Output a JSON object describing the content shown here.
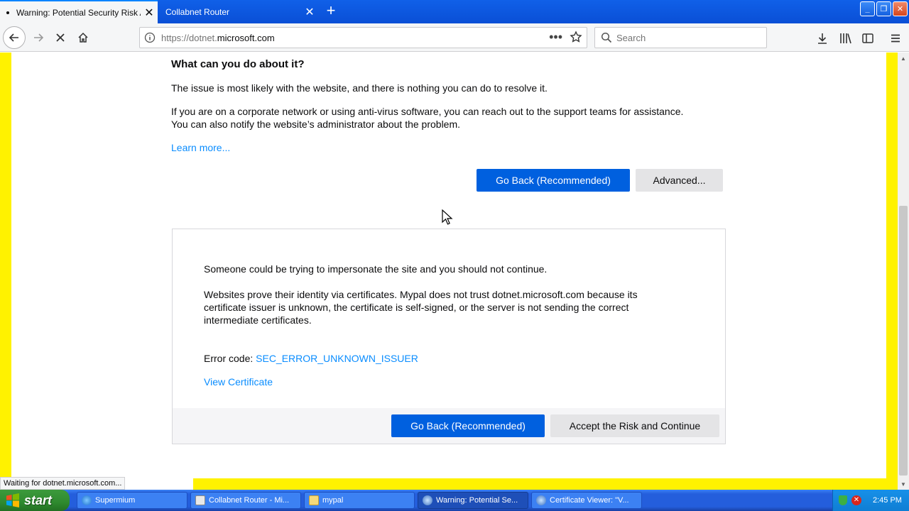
{
  "browser": {
    "tabs": [
      {
        "label": "Warning: Potential Security Risk Ahead",
        "active": true
      },
      {
        "label": "Collabnet Router",
        "active": false
      }
    ],
    "url": {
      "prefix": "https://dotnet.",
      "domain": "microsoft.com"
    },
    "search_placeholder": "Search",
    "status_text": "Waiting for dotnet.microsoft.com..."
  },
  "page": {
    "heading": "What can you do about it?",
    "para1": "The issue is most likely with the website, and there is nothing you can do to resolve it.",
    "para2_line1": "If you are on a corporate network or using anti-virus software, you can reach out to the support teams for assistance.",
    "para2_line2": "You can also notify the website’s administrator about the problem.",
    "learn_more": "Learn more...",
    "go_back_label": "Go Back (Recommended)",
    "advanced_label": "Advanced...",
    "advanced": {
      "intro": "Someone could be trying to impersonate the site and you should not continue.",
      "details": "Websites prove their identity via certificates. Mypal does not trust dotnet.microsoft.com because its certificate issuer is unknown, the certificate is self-signed, or the server is not sending the correct intermediate certificates.",
      "error_code_label": "Error code:",
      "error_code": "SEC_ERROR_UNKNOWN_ISSUER",
      "view_certificate": "View Certificate",
      "go_back_label": "Go Back (Recommended)",
      "accept_label": "Accept the Risk and Continue"
    }
  },
  "taskbar": {
    "start_label": "start",
    "tasks": [
      {
        "label": "Supermium",
        "active": false
      },
      {
        "label": "Collabnet Router - Mi...",
        "active": false
      },
      {
        "label": "mypal",
        "active": false
      },
      {
        "label": "Warning: Potential Se...",
        "active": true
      },
      {
        "label": "Certificate Viewer: \"V...",
        "active": false
      }
    ],
    "clock": "2:45 PM"
  },
  "colors": {
    "accent": "#0060df",
    "link": "#0a8dff",
    "warning_stripe": "#fff200",
    "taskbar_blue": "#245edc",
    "start_green": "#2f8a2f"
  }
}
